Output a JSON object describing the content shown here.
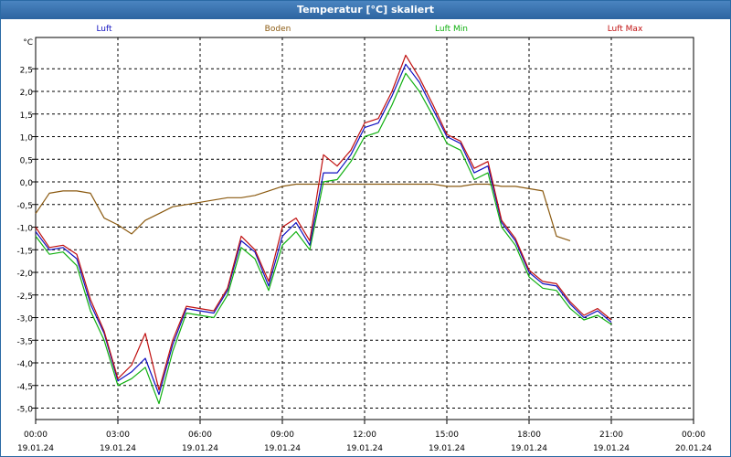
{
  "window": {
    "title": "Temperatur [°C] skaliert"
  },
  "chart_data": {
    "type": "line",
    "title": "Temperatur [°C] skaliert",
    "ylabel": "°C",
    "xlabel": "",
    "ylim": [
      -5.3,
      3.0
    ],
    "grid": true,
    "legend_position": "top",
    "y_ticks": [
      "2,5",
      "2,0",
      "1,5",
      "1,0",
      "0,5",
      "0,0",
      "-0,5",
      "-1,0",
      "-1,5",
      "-2,0",
      "-2,5",
      "-3,0",
      "-3,5",
      "-4,0",
      "-4,5",
      "-5,0"
    ],
    "x_ticks": [
      {
        "time": "00:00",
        "date": "19.01.24"
      },
      {
        "time": "03:00",
        "date": "19.01.24"
      },
      {
        "time": "06:00",
        "date": "19.01.24"
      },
      {
        "time": "09:00",
        "date": "19.01.24"
      },
      {
        "time": "12:00",
        "date": "19.01.24"
      },
      {
        "time": "15:00",
        "date": "19.01.24"
      },
      {
        "time": "18:00",
        "date": "19.01.24"
      },
      {
        "time": "21:00",
        "date": "19.01.24"
      },
      {
        "time": "00:00",
        "date": "20.01.24"
      }
    ],
    "x": [
      0,
      0.5,
      1,
      1.5,
      2,
      2.5,
      3,
      3.5,
      4,
      4.5,
      5,
      5.5,
      6,
      6.5,
      7,
      7.5,
      8,
      8.5,
      9,
      9.5,
      10,
      10.5,
      11,
      11.5,
      12,
      12.5,
      13,
      13.5,
      14,
      14.5,
      15,
      15.5,
      16,
      16.5,
      17,
      17.5,
      18,
      18.5,
      19,
      19.5,
      20,
      20.5,
      21,
      21.5,
      22,
      22.5,
      23,
      23.5,
      24
    ],
    "series": [
      {
        "name": "Luft",
        "color": "#1010c0",
        "values": [
          -1.1,
          -1.5,
          -1.45,
          -1.7,
          -2.7,
          -3.35,
          -4.4,
          -4.2,
          -3.9,
          -4.7,
          -3.6,
          -2.8,
          -2.85,
          -2.9,
          -2.4,
          -1.3,
          -1.55,
          -2.3,
          -1.2,
          -0.9,
          -1.4,
          0.2,
          0.2,
          0.6,
          1.2,
          1.3,
          1.9,
          2.6,
          2.2,
          1.6,
          1.0,
          0.85,
          0.2,
          0.35,
          -0.9,
          -1.3,
          -2.0,
          -2.25,
          -2.3,
          -2.7,
          -3.0,
          -2.85,
          -3.1,
          null,
          null,
          null,
          null,
          null,
          null
        ]
      },
      {
        "name": "Boden",
        "color": "#8b5a10",
        "values": [
          -0.7,
          -0.25,
          -0.2,
          -0.2,
          -0.25,
          -0.8,
          -0.95,
          -1.15,
          -0.85,
          -0.7,
          -0.55,
          -0.5,
          -0.45,
          -0.4,
          -0.35,
          -0.35,
          -0.3,
          -0.2,
          -0.1,
          -0.05,
          -0.05,
          -0.05,
          -0.05,
          -0.05,
          -0.05,
          -0.05,
          -0.05,
          -0.05,
          -0.05,
          -0.05,
          -0.1,
          -0.1,
          -0.05,
          -0.05,
          -0.1,
          -0.1,
          -0.15,
          -0.2,
          -1.2,
          -1.3,
          null,
          null,
          null,
          null,
          null,
          null,
          null,
          null,
          null
        ]
      },
      {
        "name": "Luft Min",
        "color": "#10b010",
        "values": [
          -1.2,
          -1.6,
          -1.55,
          -1.85,
          -2.85,
          -3.5,
          -4.5,
          -4.35,
          -4.1,
          -4.9,
          -3.75,
          -2.9,
          -2.95,
          -3.0,
          -2.5,
          -1.45,
          -1.7,
          -2.4,
          -1.4,
          -1.1,
          -1.5,
          0.0,
          0.05,
          0.45,
          1.0,
          1.1,
          1.7,
          2.4,
          2.0,
          1.45,
          0.85,
          0.7,
          0.05,
          0.2,
          -1.0,
          -1.4,
          -2.1,
          -2.35,
          -2.4,
          -2.8,
          -3.05,
          -2.95,
          -3.15,
          null,
          null,
          null,
          null,
          null,
          null
        ]
      },
      {
        "name": "Luft Max",
        "color": "#c01010",
        "values": [
          -1.0,
          -1.45,
          -1.4,
          -1.6,
          -2.6,
          -3.3,
          -4.35,
          -4.05,
          -3.35,
          -4.6,
          -3.5,
          -2.75,
          -2.8,
          -2.85,
          -2.35,
          -1.2,
          -1.5,
          -2.2,
          -1.0,
          -0.8,
          -1.3,
          0.6,
          0.35,
          0.7,
          1.3,
          1.4,
          2.0,
          2.8,
          2.3,
          1.7,
          1.05,
          0.9,
          0.3,
          0.45,
          -0.85,
          -1.25,
          -1.95,
          -2.2,
          -2.25,
          -2.65,
          -2.95,
          -2.8,
          -3.05,
          null,
          null,
          null,
          null,
          null,
          null
        ]
      }
    ]
  }
}
